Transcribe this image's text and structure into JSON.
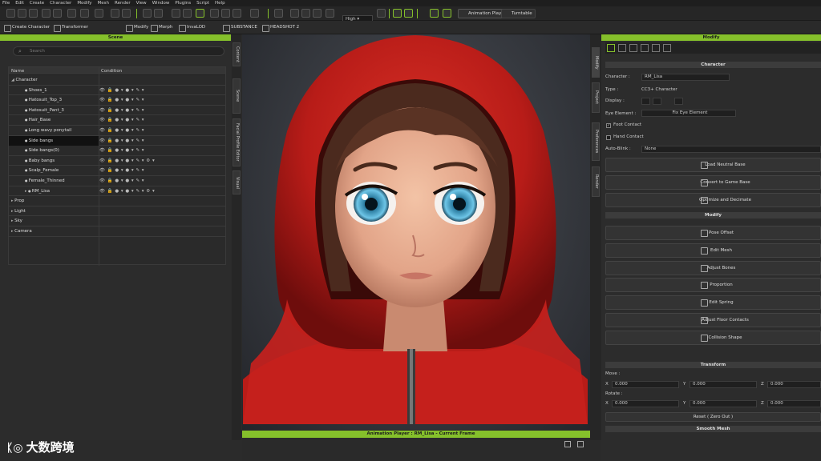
{
  "menu": [
    "File",
    "Edit",
    "Create",
    "Character",
    "Modify",
    "Mesh",
    "Render",
    "View",
    "Window",
    "Plugins",
    "Script",
    "Help"
  ],
  "toolbar": {
    "quality": "High",
    "animation_player": "Animation Player",
    "turntable": "Turntable"
  },
  "toolbar2": {
    "create_character": "Create Character",
    "transformer": "Transformer",
    "modify": "Modify",
    "morph": "Morph",
    "invalod": "InvaLOD",
    "substance": "SUBSTANCE",
    "headshot": "HEADSHOT 2"
  },
  "scene": {
    "title": "Scene",
    "search_placeholder": "Search",
    "col_name": "Name",
    "col_condition": "Condition",
    "rows": [
      {
        "label": "Character",
        "indent": 0,
        "arrow": "◢",
        "cond": ""
      },
      {
        "label": "Shoes_1",
        "indent": 1,
        "arrow": "",
        "cond": "👁 🔒 ● ▾ ● ▾ ✎ ▾"
      },
      {
        "label": "Hatosuit_Top_3",
        "indent": 1,
        "arrow": "",
        "cond": "👁 🔒 ● ▾ ● ▾ ✎ ▾"
      },
      {
        "label": "Hatosuit_Pant_3",
        "indent": 1,
        "arrow": "",
        "cond": "👁 🔒 ● ▾ ● ▾ ✎ ▾"
      },
      {
        "label": "Hair_Base",
        "indent": 1,
        "arrow": "",
        "cond": "👁 🔒 ● ▾ ● ▾ ✎ ▾"
      },
      {
        "label": "Long wavy ponytail",
        "indent": 1,
        "arrow": "",
        "cond": "👁 🔒 ● ▾ ● ▾ ✎ ▾"
      },
      {
        "label": "Side bangs",
        "indent": 1,
        "arrow": "",
        "cond": "👁 🔒 ● ▾ ● ▾ ✎ ▾",
        "sel": true
      },
      {
        "label": "Side bangs(0)",
        "indent": 1,
        "arrow": "",
        "cond": "👁 🔒 ● ▾ ● ▾ ✎ ▾"
      },
      {
        "label": "Baby bangs",
        "indent": 1,
        "arrow": "",
        "cond": "👁 🔒 ● ▾ ● ▾ ✎ ▾ ⚙ ▾"
      },
      {
        "label": "Scalp_Female",
        "indent": 1,
        "arrow": "",
        "cond": "👁 🔒 ● ▾ ● ▾ ✎ ▾"
      },
      {
        "label": "Female_Thinned",
        "indent": 1,
        "arrow": "",
        "cond": "👁 🔒 ● ▾ ● ▾ ✎ ▾"
      },
      {
        "label": "RM_Lisa",
        "indent": 1,
        "arrow": "▸",
        "cond": "👁 🔒 ● ▾ ● ▾ ✎ ▾ ⚙ ▾"
      },
      {
        "label": "Prop",
        "indent": 0,
        "arrow": "▸",
        "cond": ""
      },
      {
        "label": "Light",
        "indent": 0,
        "arrow": "▸",
        "cond": ""
      },
      {
        "label": "Sky",
        "indent": 0,
        "arrow": "▸",
        "cond": ""
      },
      {
        "label": "Camera",
        "indent": 0,
        "arrow": "▸",
        "cond": ""
      }
    ]
  },
  "side_tabs": [
    "Content",
    "Scene",
    "Facial Profile Editor",
    "Visual"
  ],
  "right_tabs": [
    "Modify",
    "Project",
    "Preferences",
    "Render"
  ],
  "animation_player": {
    "title": "Animation Player : RM_Lisa - Current Frame"
  },
  "modify": {
    "title": "Modify",
    "section_character": "Character",
    "character_label": "Character :",
    "character_value": "RM_Lisa",
    "type_label": "Type :",
    "type_value": "CC3+ Character",
    "display_label": "Display :",
    "eye_element_label": "Eye Element :",
    "fix_eye_button": "Fix Eye Element",
    "foot_contact": "Foot Contact",
    "hand_contact": "Hand Contact",
    "auto_blink_label": "Auto-Blink :",
    "auto_blink_value": "None",
    "buttons_character": [
      "Load Neutral Base",
      "Convert to Game Base",
      "Optimize and Decimate"
    ],
    "section_modify": "Modify",
    "buttons_modify": [
      "Pose Offset",
      "Edit Mesh",
      "Adjust Bones",
      "Proportion",
      "Edit Spring",
      "Adjust Floor Contacts",
      "Collision Shape"
    ],
    "section_transform": "Transform",
    "move_label": "Move :",
    "rotate_label": "Rotate :",
    "axis_x": "X",
    "axis_y": "Y",
    "axis_z": "Z",
    "move": [
      "0.000",
      "0.000",
      "0.000"
    ],
    "rotate": [
      "0.000",
      "0.000",
      "0.000"
    ],
    "reset_button": "Reset ( Zero Out )",
    "section_smooth": "Smooth Mesh"
  },
  "watermark": "大数跨境",
  "colors": {
    "accent": "#85c02b",
    "hood": "#c2201d"
  }
}
